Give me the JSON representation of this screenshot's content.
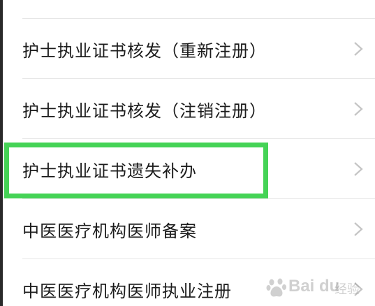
{
  "menu": {
    "items": [
      {
        "label": "护士执业证书核发（重新注册）"
      },
      {
        "label": "护士执业证书核发（注销注册）"
      },
      {
        "label": "护士执业证书遗失补办"
      },
      {
        "label": "中医医疗机构医师备案"
      },
      {
        "label": "中医医疗机构医师执业注册"
      }
    ]
  },
  "highlight": {
    "color": "#45d356",
    "target_item": 2
  },
  "watermark": {
    "brand": "Bai du",
    "sub": "经验"
  }
}
